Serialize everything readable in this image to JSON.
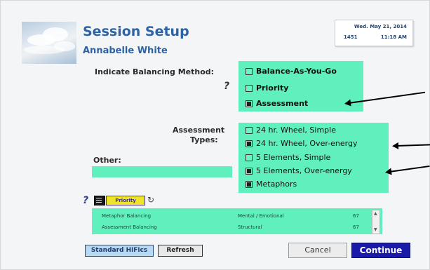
{
  "header": {
    "title": "Session Setup",
    "user_name": "Annabelle White",
    "date": "Wed. May 21, 2014",
    "session_id": "1451",
    "time": "11:18 AM"
  },
  "balancing": {
    "label": "Indicate Balancing Method:",
    "help": "?",
    "options": [
      {
        "label": "Balance-As-You-Go",
        "checked": false
      },
      {
        "label": "Priority",
        "checked": false
      },
      {
        "label": "Assessment",
        "checked": true
      }
    ]
  },
  "assessment": {
    "label_line1": "Assessment",
    "label_line2": "Types:",
    "options": [
      {
        "label": "24 hr. Wheel, Simple",
        "checked": false
      },
      {
        "label": "24 hr. Wheel, Over-energy",
        "checked": true
      },
      {
        "label": "5 Elements, Simple",
        "checked": false
      },
      {
        "label": "5 Elements, Over-energy",
        "checked": true
      },
      {
        "label": "Metaphors",
        "checked": true
      }
    ]
  },
  "other": {
    "label": "Other:",
    "value": ""
  },
  "priority_bar": {
    "help": "?",
    "priority_label": "Priority"
  },
  "table": {
    "rows": [
      {
        "name": "Metaphor Balancing",
        "category": "Mental / Emotional",
        "count": "67"
      },
      {
        "name": "Assessment Balancing",
        "category": "Structural",
        "count": "67"
      }
    ]
  },
  "buttons": {
    "standard_hifis": "Standard HiFics",
    "refresh": "Refresh",
    "cancel": "Cancel",
    "continue": "Continue"
  },
  "colors": {
    "accent_green": "#5ff0bd",
    "title_blue": "#2d63a5",
    "continue_bg": "#1a1aa8"
  }
}
